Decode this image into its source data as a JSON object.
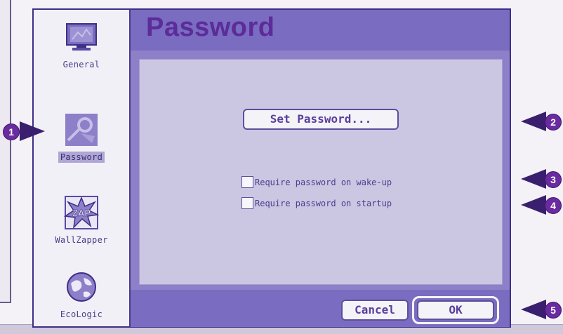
{
  "sidebar": {
    "items": [
      {
        "label": "General",
        "icon": "monitor-icon"
      },
      {
        "label": "Password",
        "icon": "password-key-icon",
        "selected": true
      },
      {
        "label": "WallZapper",
        "icon": "zap-icon"
      },
      {
        "label": "EcoLogic",
        "icon": "globe-icon"
      }
    ]
  },
  "panel": {
    "title": "Password",
    "set_password_label": "Set Password...",
    "options": [
      {
        "label": "Require password on wake-up",
        "checked": false
      },
      {
        "label": "Require password on startup",
        "checked": false
      }
    ]
  },
  "footer": {
    "cancel_label": "Cancel",
    "ok_label": "OK"
  },
  "callouts": [
    "1",
    "2",
    "3",
    "4",
    "5"
  ],
  "colors": {
    "accent": "#7a6cc0",
    "title_text": "#5c2c9a",
    "content_bg": "#cbc6e2",
    "callout": "#6a2aa0"
  }
}
